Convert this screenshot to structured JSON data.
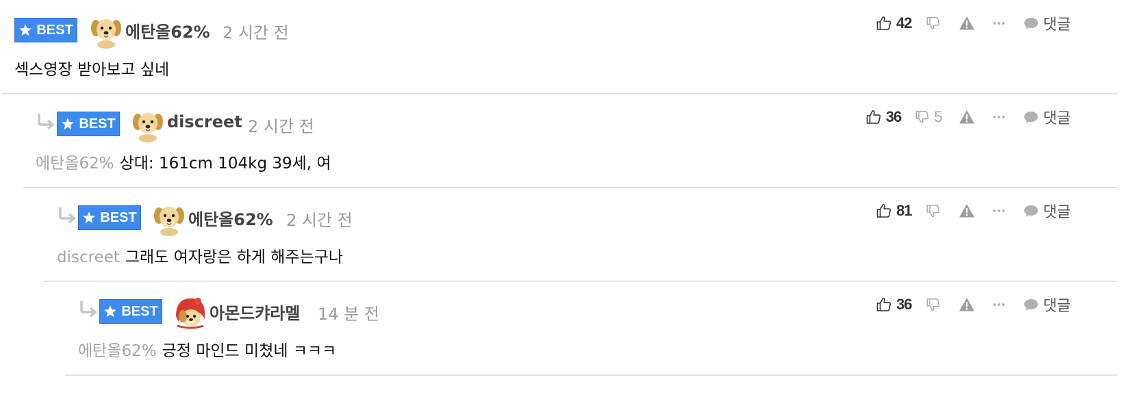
{
  "best_label": "BEST",
  "reply_label": "댓글",
  "comments": [
    {
      "username": "에탄올62%",
      "time": "2 시간 전",
      "mention": "",
      "text": "섹스영장 받아보고 싶네",
      "likes": "42",
      "dislikes": "",
      "avatar": "dog-avatar"
    },
    {
      "username": "discreet",
      "time": "2 시간 전",
      "mention": "에탄올62%",
      "text": "상대: 161cm 104kg 39세, 여",
      "likes": "36",
      "dislikes": "5",
      "avatar": "dog-avatar"
    },
    {
      "username": "에탄올62%",
      "time": "2 시간 전",
      "mention": "discreet",
      "text": "그래도 여자랑은 하게 해주는구나",
      "likes": "81",
      "dislikes": "",
      "avatar": "dog-avatar"
    },
    {
      "username": "아몬드캬라멜",
      "time": "14 분 전",
      "mention": "에탄올62%",
      "text": "긍정 마인드 미쳤네 ㅋㅋㅋ",
      "likes": "36",
      "dislikes": "",
      "avatar": "dog-hood-avatar"
    }
  ]
}
